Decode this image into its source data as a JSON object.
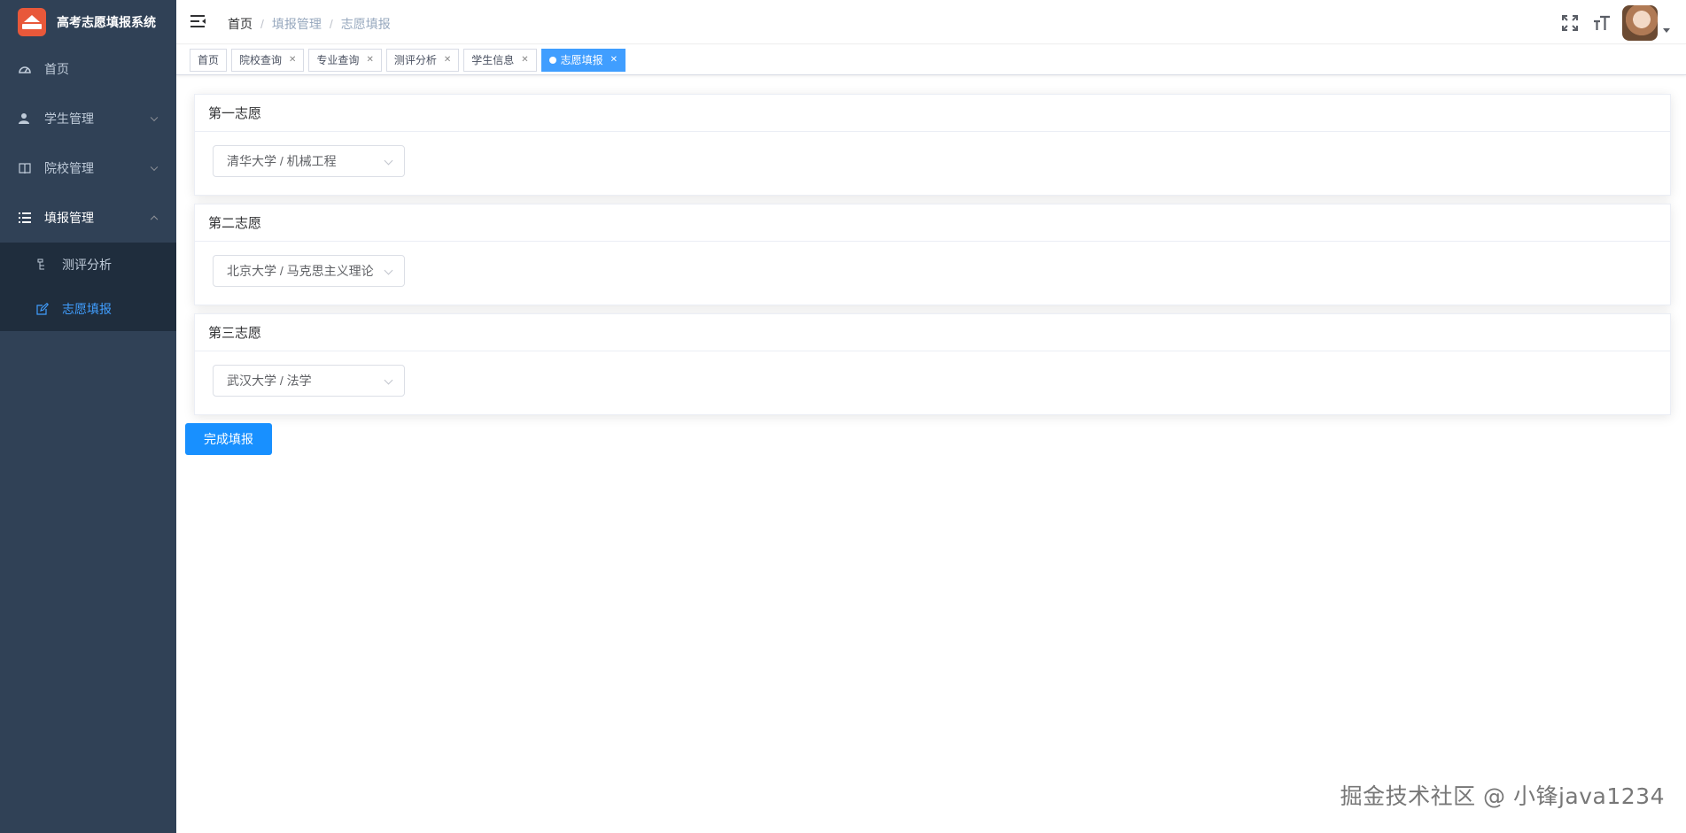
{
  "app": {
    "title": "高考志愿填报系统",
    "logo_icon": "graduation-cap-icon"
  },
  "sidebar": {
    "items": [
      {
        "label": "首页",
        "icon": "dashboard-icon"
      },
      {
        "label": "学生管理",
        "icon": "user-icon"
      },
      {
        "label": "院校管理",
        "icon": "book-icon"
      },
      {
        "label": "填报管理",
        "icon": "list-icon"
      }
    ],
    "subitems": [
      {
        "label": "测评分析",
        "icon": "tree-icon"
      },
      {
        "label": "志愿填报",
        "icon": "edit-icon"
      }
    ]
  },
  "breadcrumb": [
    "首页",
    "填报管理",
    "志愿填报"
  ],
  "tags": [
    {
      "label": "首页",
      "closable": false
    },
    {
      "label": "院校查询",
      "closable": true
    },
    {
      "label": "专业查询",
      "closable": true
    },
    {
      "label": "测评分析",
      "closable": true
    },
    {
      "label": "学生信息",
      "closable": true
    },
    {
      "label": "志愿填报",
      "closable": true,
      "active": true
    }
  ],
  "choices": [
    {
      "title": "第一志愿",
      "value": "清华大学 / 机械工程"
    },
    {
      "title": "第二志愿",
      "value": "北京大学 / 马克思主义理论"
    },
    {
      "title": "第三志愿",
      "value": "武汉大学 / 法学"
    }
  ],
  "submit_label": "完成填报",
  "watermark": "掘金技术社区 @ 小锋java1234",
  "colors": {
    "sidebar_bg": "#304156",
    "submenu_bg": "#1f2d3d",
    "accent": "#409eff",
    "button": "#1890ff"
  }
}
